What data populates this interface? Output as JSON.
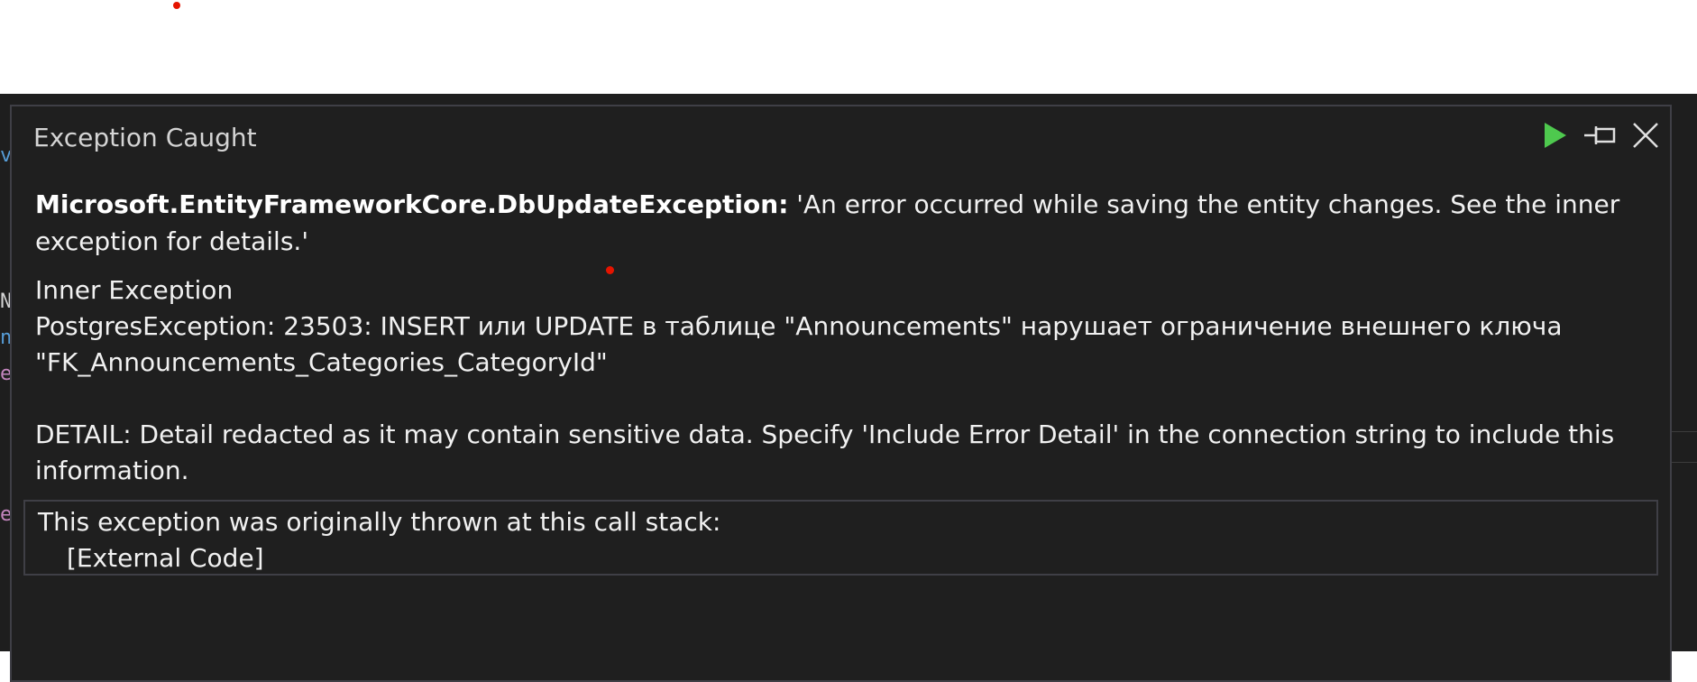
{
  "popup": {
    "title": "Exception Caught",
    "toolbar": {
      "continue_icon": "play-icon",
      "pin_icon": "pin-icon",
      "close_icon": "close-icon",
      "continue_color": "#4ec94e"
    },
    "exception": {
      "type": "Microsoft.EntityFrameworkCore.DbUpdateException:",
      "message": " 'An error occurred while saving the entity changes. See the inner exception for details.'"
    },
    "inner_exception": {
      "title": "Inner Exception",
      "body": "PostgresException: 23503: INSERT или UPDATE в таблице \"Announcements\" нарушает ограничение внешнего ключа \"FK_Announcements_Categories_CategoryId\"\n\nDETAIL: Detail redacted as it may contain sensitive data. Specify 'Include Error Detail' in the connection string to include this information."
    },
    "call_stack": {
      "header": "This exception was originally thrown at this call stack:",
      "frames": [
        "[External Code]"
      ]
    }
  },
  "colors": {
    "popup_bg": "#1f1f1f",
    "border": "#3f3f46",
    "text": "#f1f1f1",
    "breakpoint_red": "#e51400"
  }
}
